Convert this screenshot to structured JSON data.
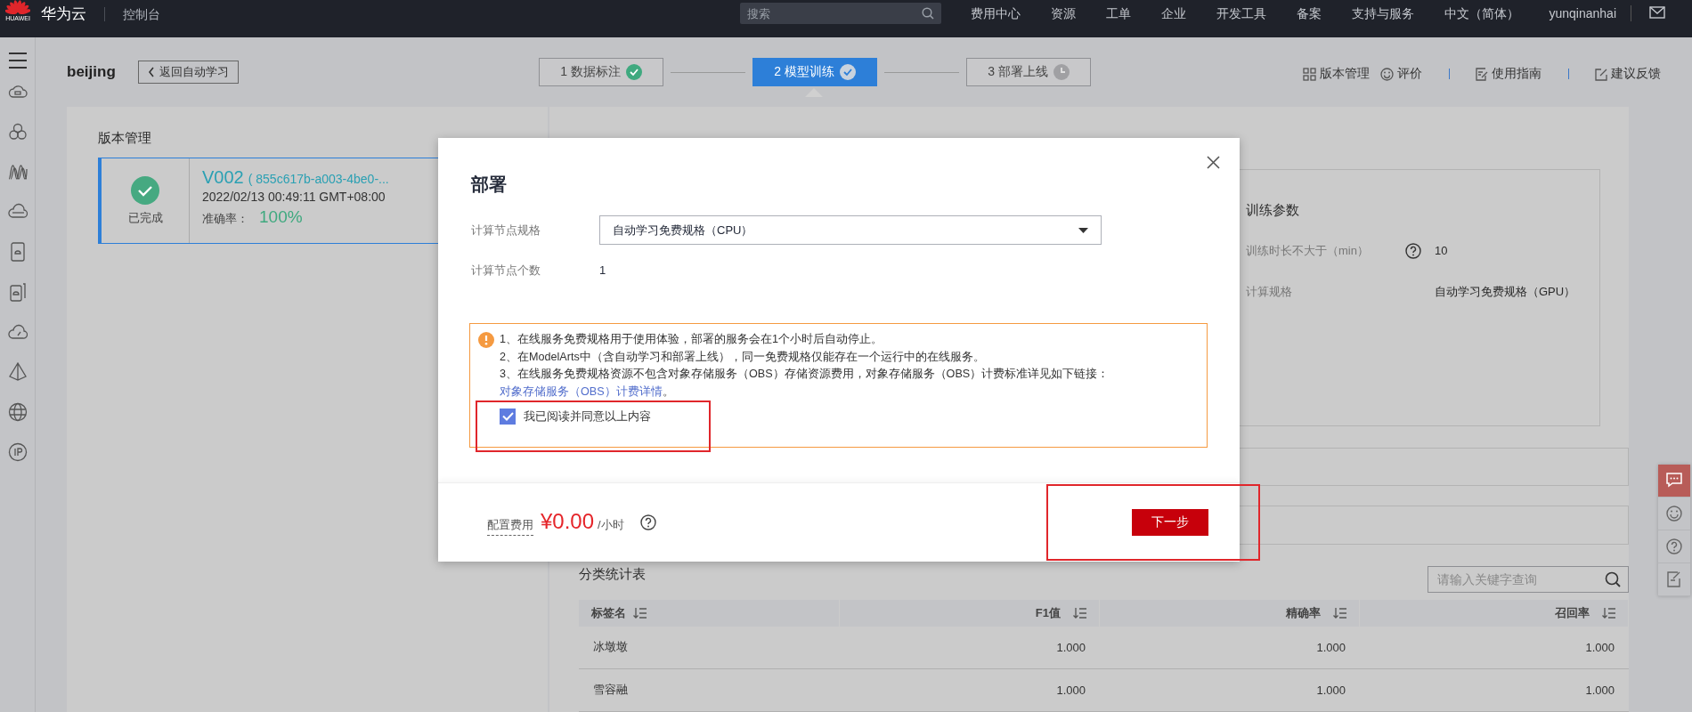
{
  "topbar": {
    "logo_text": "HUAWEI",
    "brand": "华为云",
    "console": "控制台",
    "search": {
      "placeholder": "搜索"
    },
    "nav": [
      "费用中心",
      "资源",
      "工单",
      "企业",
      "开发工具",
      "备案",
      "支持与服务",
      "中文（简体）"
    ],
    "user": "yunqinanhai"
  },
  "sidebar": {
    "icons": [
      {
        "kind": "cloud-chip"
      },
      {
        "kind": "cluster"
      },
      {
        "kind": "wave"
      },
      {
        "kind": "cloud-disk"
      },
      {
        "kind": "phone"
      },
      {
        "kind": "cards"
      },
      {
        "kind": "cloud-gauge"
      },
      {
        "kind": "pyramid"
      },
      {
        "kind": "globe"
      },
      {
        "kind": "ip"
      }
    ]
  },
  "header": {
    "project": "beijing",
    "back": "返回自动学习",
    "steps": [
      {
        "label": "1 数据标注",
        "completed": true,
        "selected": false
      },
      {
        "label": "2 模型训练",
        "completed": true,
        "selected": true
      },
      {
        "label": "3 部署上线",
        "completed": false,
        "selected": false
      }
    ],
    "links": [
      {
        "kind": "grid",
        "label": "版本管理"
      },
      {
        "kind": "smile",
        "label": "评价"
      },
      {
        "kind": "guide",
        "label": "使用指南"
      },
      {
        "kind": "feedback",
        "label": "建议反馈"
      }
    ]
  },
  "versions": {
    "title": "版本管理",
    "items": [
      {
        "completed": true,
        "status": "已完成",
        "name": "V002",
        "id": "( 855c617b-a003-4be0-...",
        "time": "2022/02/13 00:49:11 GMT+08:00",
        "accuracy_label": "准确率：",
        "accuracy": "100%",
        "selected": true
      }
    ]
  },
  "training": {
    "params_title": "训练参数",
    "params": [
      {
        "label": "训练时长不大于（min）",
        "help": true,
        "value": "10"
      },
      {
        "label": "计算规格",
        "help": false,
        "value": "自动学习免费规格（GPU）"
      }
    ]
  },
  "stats": {
    "title": "分类统计表",
    "search": {
      "placeholder": "请输入关键字查询"
    },
    "columns": [
      "标签名",
      "F1值",
      "精确率",
      "召回率"
    ],
    "rows": [
      [
        "冰墩墩",
        "1.000",
        "1.000",
        "1.000"
      ],
      [
        "雪容融",
        "1.000",
        "1.000",
        "1.000"
      ]
    ]
  },
  "float_tools": [
    {
      "kind": "chat",
      "selected": true
    },
    {
      "kind": "smile",
      "selected": false
    },
    {
      "kind": "help",
      "selected": false
    },
    {
      "kind": "edit",
      "selected": false
    }
  ],
  "dialog": {
    "title": "部署",
    "fields": [
      {
        "kind": "select",
        "label": "计算节点规格",
        "value": "自动学习免费规格（CPU）"
      },
      {
        "kind": "text",
        "label": "计算节点个数",
        "value": "1"
      }
    ],
    "notice": {
      "lines": [
        "1、在线服务免费规格用于使用体验，部署的服务会在1个小时后自动停止。",
        "2、在ModelArts中（含自动学习和部署上线），同一免费规格仅能存在一个运行中的在线服务。",
        "3、在线服务免费规格资源不包含对象存储服务（OBS）存储资源费用，对象存储服务（OBS）计费标准详见如下链接："
      ],
      "link": "对象存储服务（OBS）计费详情",
      "end": "。"
    },
    "agree": {
      "label": "我已阅读并同意以上内容",
      "checked": true,
      "highlighted": true
    },
    "fee_label": "配置费用",
    "price": "¥0.00",
    "unit": "/小时",
    "next": {
      "label": "下一步",
      "highlighted": true
    }
  }
}
